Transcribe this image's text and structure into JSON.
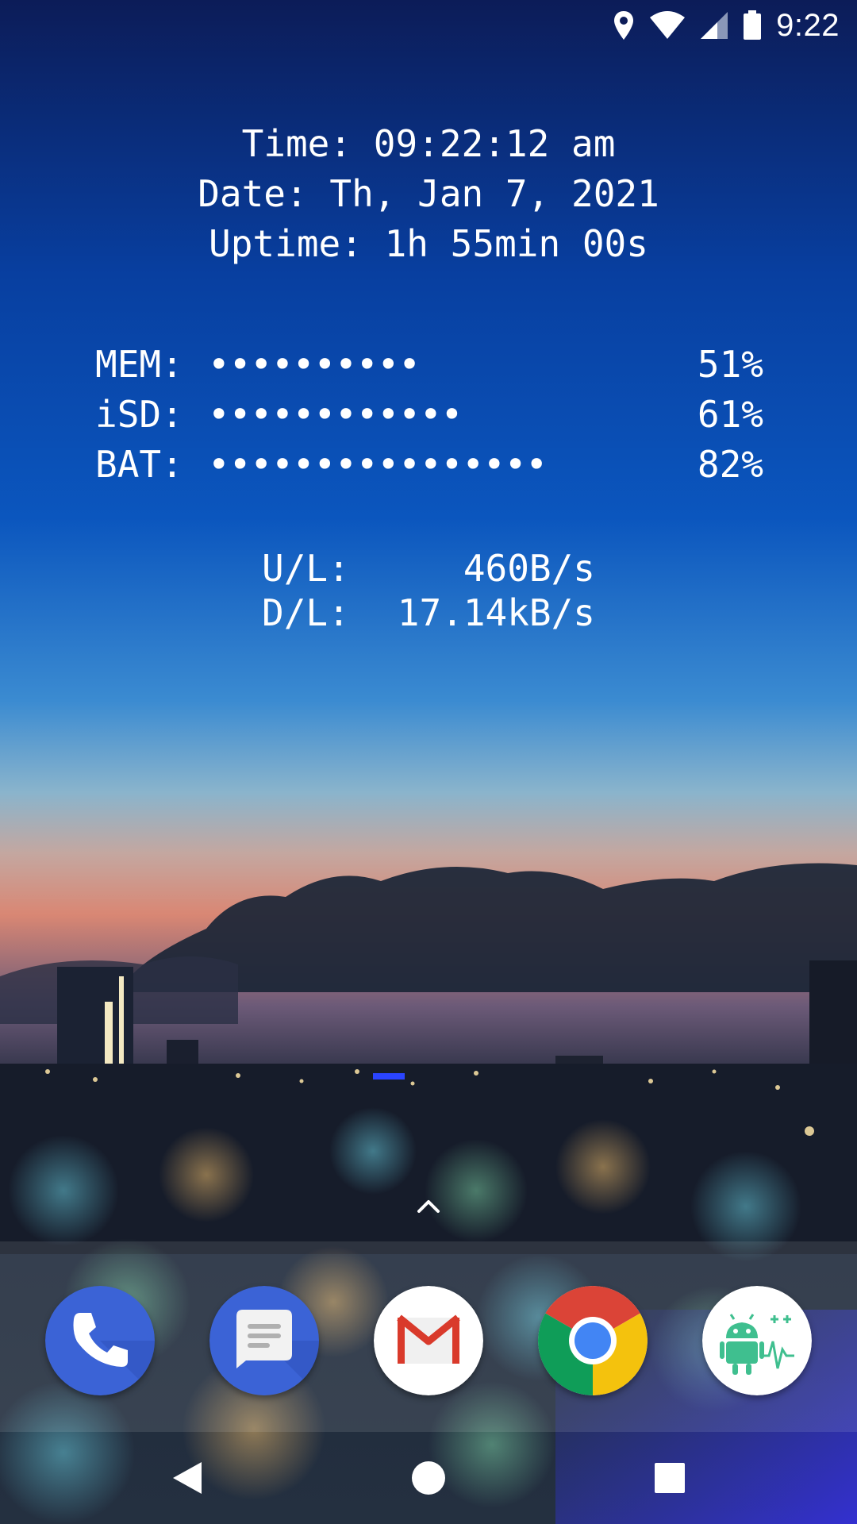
{
  "status_bar": {
    "time": "9:22",
    "icons": [
      "location-icon",
      "wifi-icon",
      "cell-signal-icon",
      "battery-icon"
    ]
  },
  "widget": {
    "clock_lines": [
      "Time: 09:22:12 am",
      "Date: Th, Jan 7, 2021",
      "Uptime: 1h 55min 00s"
    ],
    "meters": [
      {
        "label": "MEM:",
        "dots": "••••••••••",
        "percent": "51%"
      },
      {
        "label": "iSD:",
        "dots": "••••••••••••",
        "percent": "61%"
      },
      {
        "label": "BAT:",
        "dots": "••••••••••••••••",
        "percent": "82%"
      }
    ],
    "network": [
      {
        "label": "U/L:",
        "value": "460B/s"
      },
      {
        "label": "D/L:",
        "value": "17.14kB/s"
      }
    ]
  },
  "dock": {
    "apps": [
      "phone-app-icon",
      "messages-app-icon",
      "gmail-app-icon",
      "chrome-app-icon",
      "system-monitor-app-icon"
    ]
  },
  "colors": {
    "sky_top": "#0b1f5c",
    "sky_mid": "#0a52b5",
    "sky_low": "#4a97d6",
    "sunset": "#e0876e",
    "phone_blue": "#3b63d6",
    "chrome_red": "#db4437",
    "chrome_green": "#0f9d58",
    "chrome_yellow": "#f4c20d",
    "chrome_blue": "#4285f4",
    "monitor_green": "#3fbf8f"
  },
  "navigation": [
    "back-button",
    "home-button",
    "recents-button"
  ]
}
